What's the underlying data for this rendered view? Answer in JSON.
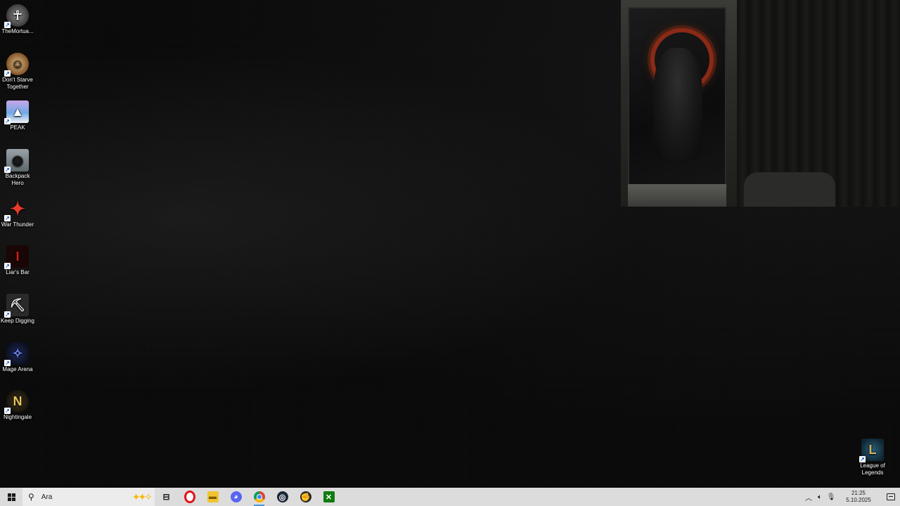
{
  "desktop": {
    "icons": [
      {
        "label": "TheMortua...",
        "icon": "mortuary-assistant-icon"
      },
      {
        "label": "Don't Starve Together",
        "icon": "dont-starve-together-icon"
      },
      {
        "label": "PEAK",
        "icon": "peak-icon"
      },
      {
        "label": "Backpack Hero",
        "icon": "backpack-hero-icon"
      },
      {
        "label": "War Thunder",
        "icon": "war-thunder-icon"
      },
      {
        "label": "Liar's Bar",
        "icon": "liars-bar-icon"
      },
      {
        "label": "Keep Digging",
        "icon": "keep-digging-icon"
      },
      {
        "label": "Mage Arena",
        "icon": "mage-arena-icon"
      },
      {
        "label": "Nightingale",
        "icon": "nightingale-icon"
      },
      {
        "label": "League of Legends",
        "icon": "league-of-legends-icon"
      }
    ]
  },
  "taskbar": {
    "search": {
      "placeholder": "Ara"
    },
    "pinned": [
      {
        "name": "task-view",
        "icon": "task-view-icon"
      },
      {
        "name": "opera",
        "icon": "opera-icon"
      },
      {
        "name": "file-explorer",
        "icon": "folder-icon"
      },
      {
        "name": "discord",
        "icon": "discord-icon"
      },
      {
        "name": "chrome",
        "icon": "chrome-icon"
      },
      {
        "name": "steam",
        "icon": "steam-icon"
      },
      {
        "name": "riot-client",
        "icon": "riot-icon"
      },
      {
        "name": "xbox",
        "icon": "xbox-icon"
      }
    ],
    "tray": {
      "time": "21:25",
      "date": "5.10.2025"
    }
  },
  "colors": {
    "taskbar_bg": "#dcdcdc",
    "desktop_bg": "#080808",
    "active_indicator": "#4a8fd8"
  }
}
